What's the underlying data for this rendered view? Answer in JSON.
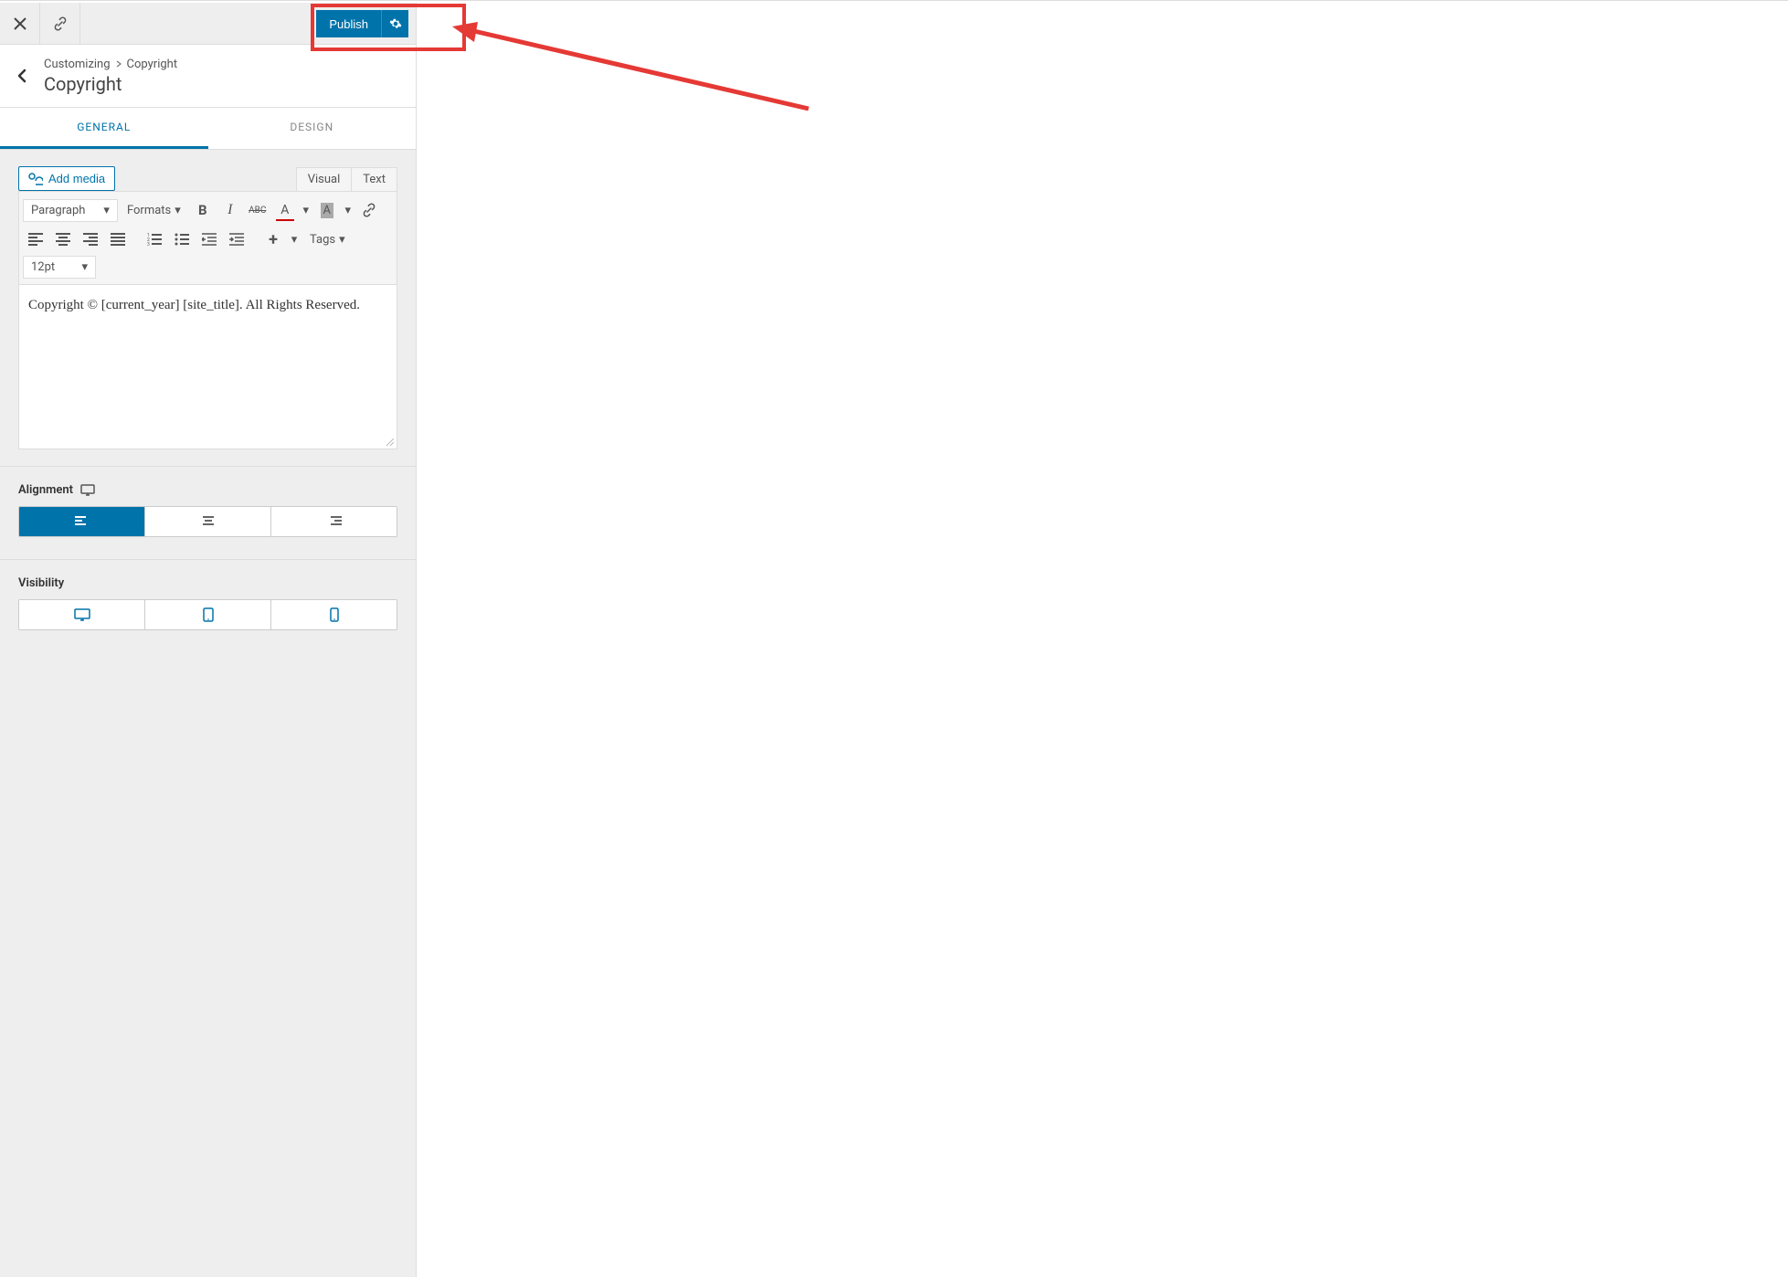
{
  "header": {
    "publish_label": "Publish"
  },
  "breadcrumb": {
    "root": "Customizing",
    "current": "Copyright",
    "title": "Copyright"
  },
  "tabs": {
    "general": "GENERAL",
    "design": "DESIGN"
  },
  "editor": {
    "add_media": "Add media",
    "visual_tab": "Visual",
    "text_tab": "Text",
    "paragraph_select": "Paragraph",
    "formats_select": "Formats",
    "tags_select": "Tags",
    "fontsize_select": "12pt",
    "content": "Copyright © [current_year] [site_title]. All Rights Reserved."
  },
  "alignment": {
    "label": "Alignment"
  },
  "visibility": {
    "label": "Visibility"
  }
}
